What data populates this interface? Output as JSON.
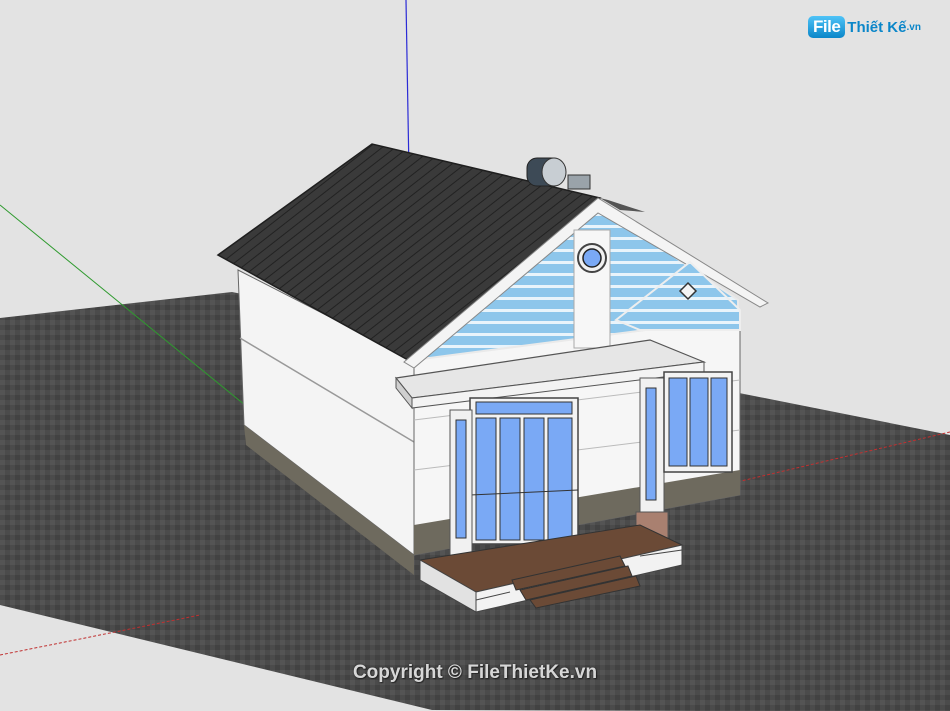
{
  "logo": {
    "file": "File",
    "brand": "Thiết Kế",
    "tld": ".vn"
  },
  "watermark": "Copyright © FileThietKe.vn",
  "colors": {
    "background": "#e3e3e3",
    "ground": "#4a4a4a",
    "roof": "#3b3b3b",
    "gable": "#8fc7ea",
    "glass": "#7aa9f5",
    "base": "#6e6a5e",
    "steps": "#6b4a36"
  }
}
